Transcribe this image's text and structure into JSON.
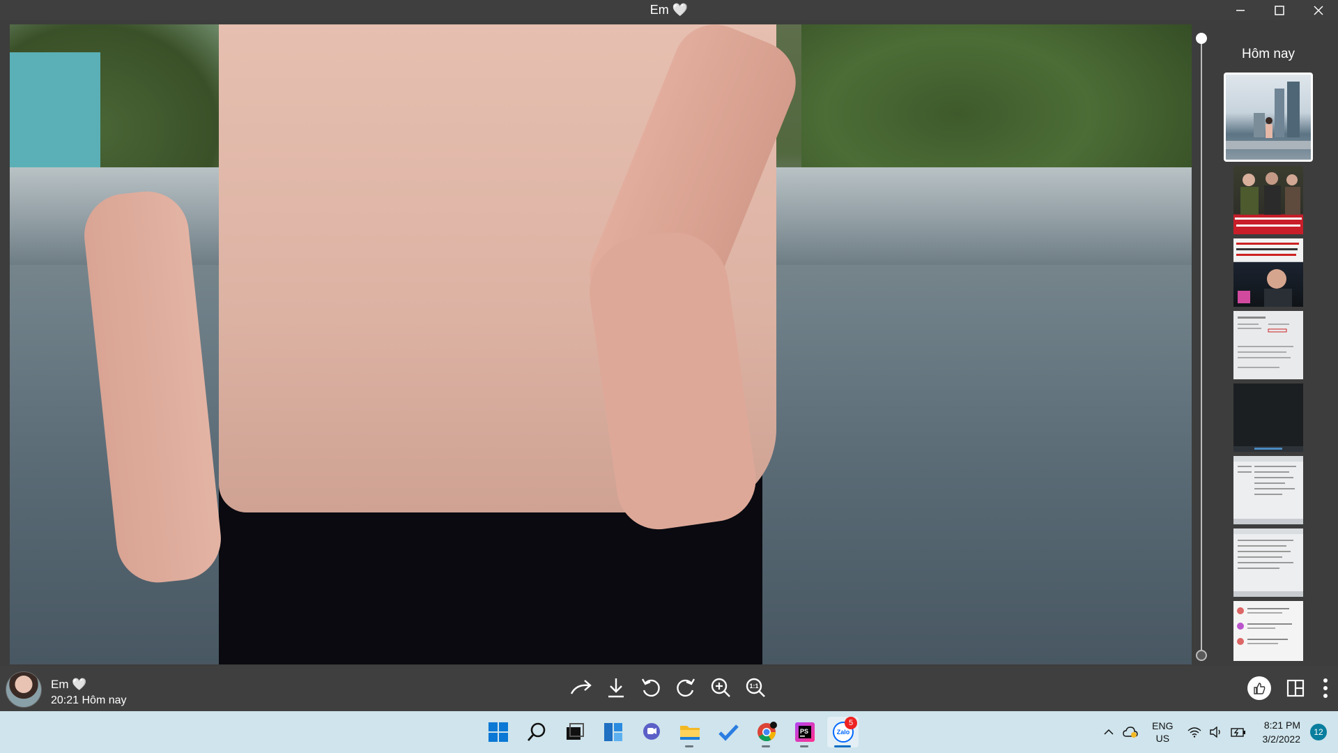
{
  "window": {
    "title": "Em 🤍"
  },
  "sidebar": {
    "day_label": "Hôm nay",
    "thumbnail_count": 8
  },
  "message": {
    "sender": "Em 🤍",
    "timestamp": "20:21 Hôm nay"
  },
  "toolbar": {
    "icons": [
      "share-forward-icon",
      "download-icon",
      "rotate-left-icon",
      "rotate-right-icon",
      "zoom-in-icon",
      "actual-size-icon"
    ],
    "actual_size_label": "1:1"
  },
  "taskbar": {
    "apps": [
      "windows-start",
      "search",
      "task-view",
      "widgets",
      "chat",
      "file-explorer",
      "todo",
      "chrome",
      "phpstorm",
      "zalo"
    ],
    "zalo_badge": "5",
    "zalo_label": "Zalo",
    "ps_label": "PS"
  },
  "tray": {
    "lang_line1": "ENG",
    "lang_line2": "US",
    "time": "8:21 PM",
    "date": "3/2/2022",
    "notifications": "12"
  },
  "colors": {
    "titlebar": "#3f3f3f",
    "taskbar": "#cfe4ec",
    "accent": "#0a6dc2"
  }
}
